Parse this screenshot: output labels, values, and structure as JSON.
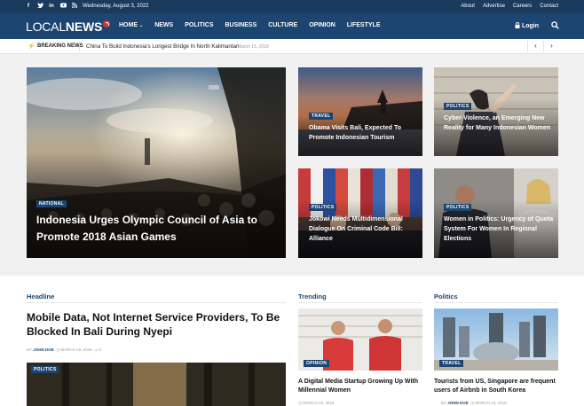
{
  "topbar": {
    "date": "Wednesday, August 3, 2022",
    "social_icons": [
      "facebook-icon",
      "twitter-icon",
      "linkedin-icon",
      "youtube-icon",
      "rss-icon"
    ],
    "links": [
      "About",
      "Advertise",
      "Careers",
      "Contact"
    ]
  },
  "header": {
    "logo_part1": "LOCAL",
    "logo_part2": "NEWS",
    "nav": [
      "HOME",
      "NEWS",
      "POLITICS",
      "BUSINESS",
      "CULTURE",
      "OPINION",
      "LIFESTYLE"
    ],
    "login": "Login"
  },
  "breaking": {
    "label": "BREAKING NEWS",
    "headline": "China To Build Indonesia's Longest Bridge In North Kalimantan",
    "date": "March 15, 2018"
  },
  "hero": [
    {
      "tag": "NATIONAL",
      "title": "Indonesia Urges Olympic Council of Asia to Promote 2018 Asian Games"
    },
    {
      "tag": "TRAVEL",
      "title": "Obama Visits Bali, Expected To Promote Indonesian Tourism"
    },
    {
      "tag": "POLITICS",
      "title": "Cyber-Violence, an Emerging New Reality for Many Indonesian Women"
    },
    {
      "tag": "POLITICS",
      "title": "Jokowi Needs Multidimensional Dialogue On Criminal Code Bill: Alliance"
    },
    {
      "tag": "POLITICS",
      "title": "Women in Politics: Urgency of Quota System For Women In Regional Elections"
    }
  ],
  "sections": {
    "headline": {
      "heading": "Headline",
      "title": "Mobile Data, Not Internet Service Providers, To Be Blocked In Bali During Nyepi",
      "by": "BY",
      "author": "JOHN DOE",
      "date": "MARCH 19, 2018",
      "comments": "0",
      "next_tag": "POLITICS"
    },
    "trending": {
      "heading": "Trending",
      "tag": "OPINION",
      "title": "A Digital Media Startup Growing Up With Millennial Women",
      "date": "MARCH 19, 2018"
    },
    "politics": {
      "heading": "Politics",
      "tag": "TRAVEL",
      "title": "Tourists from US, Singapore are frequent users of Airbnb in South Korea",
      "by": "BY",
      "author": "JOHN DOE",
      "date": "MARCH 19, 2018"
    }
  },
  "colors": {
    "topbar": "#1a3a5e",
    "header": "#1c4571",
    "accent": "#1c4571",
    "logo_dot": "#d9322e"
  }
}
